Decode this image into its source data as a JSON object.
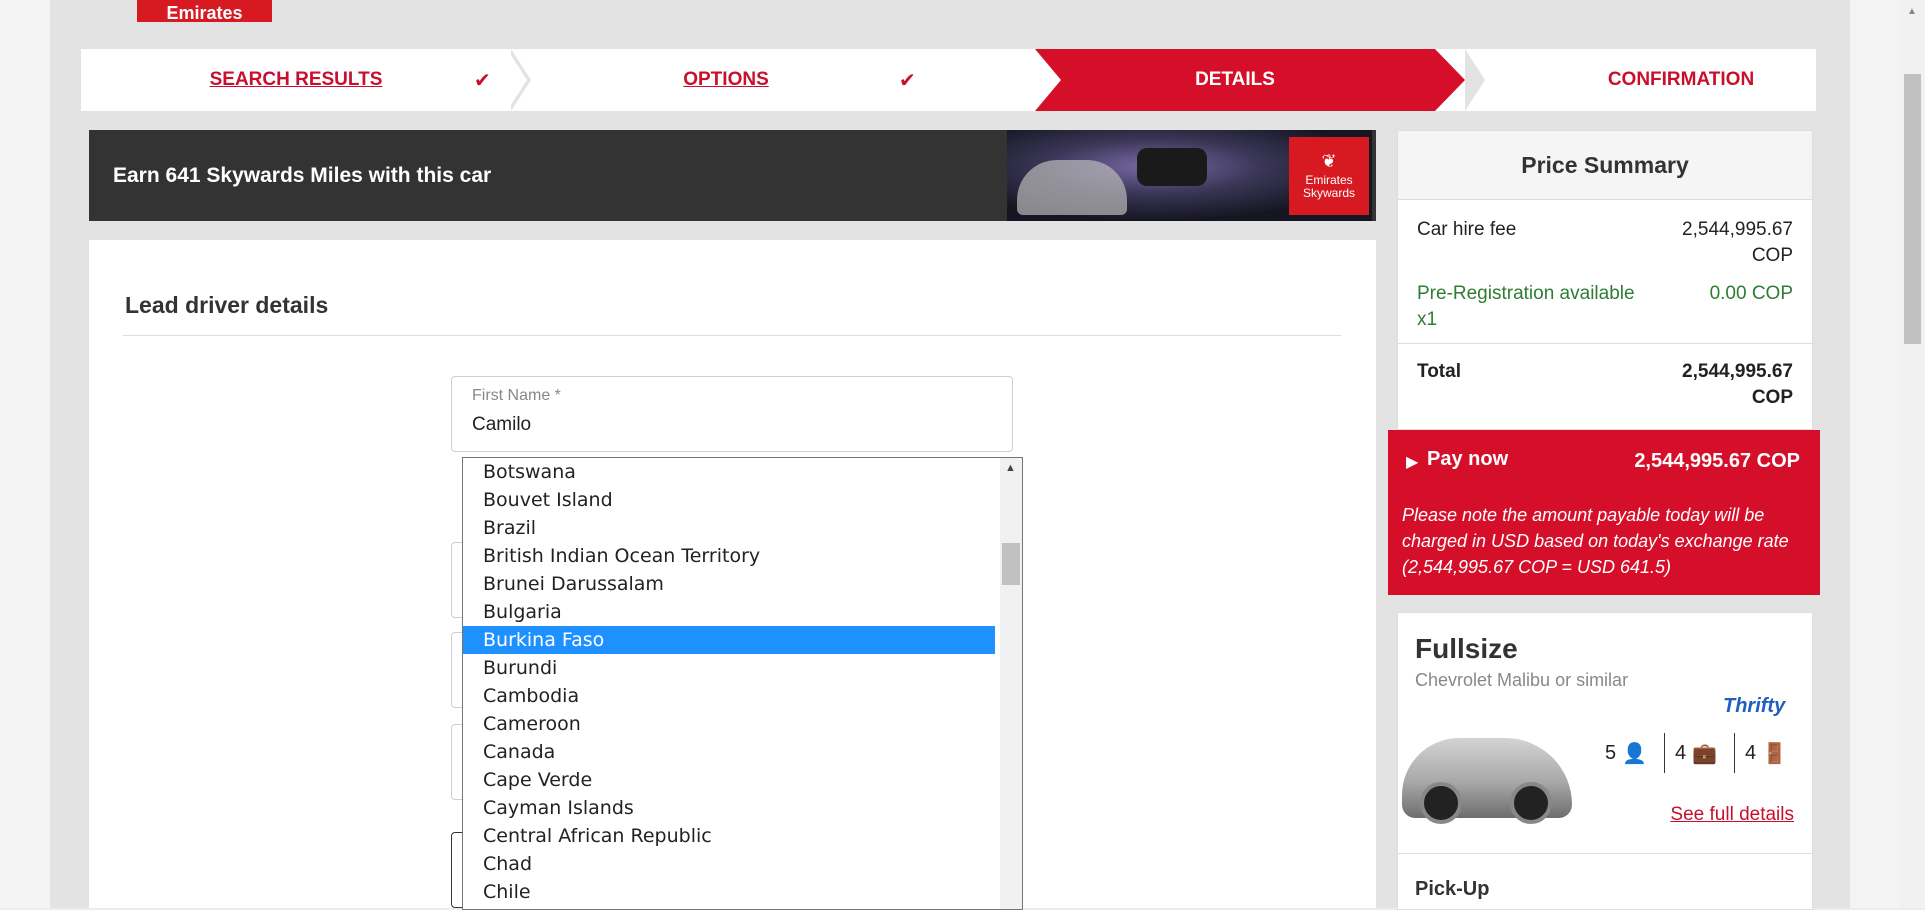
{
  "brand": {
    "logo_text": "Emirates"
  },
  "steps": [
    {
      "label": "SEARCH RESULTS",
      "done": true
    },
    {
      "label": "OPTIONS",
      "done": true
    },
    {
      "label": "DETAILS",
      "active": true
    },
    {
      "label": "CONFIRMATION"
    }
  ],
  "banner": {
    "text": "Earn 641 Skywards Miles with this car",
    "logo_line1": "Emirates",
    "logo_line2": "Skywards"
  },
  "form": {
    "section_title": "Lead driver details",
    "first_name": {
      "label": "First Name *",
      "value": "Camilo"
    }
  },
  "country_dropdown": {
    "selected": "Burkina Faso",
    "items": [
      "Botswana",
      "Bouvet Island",
      "Brazil",
      "British Indian Ocean Territory",
      "Brunei Darussalam",
      "Bulgaria",
      "Burkina Faso",
      "Burundi",
      "Cambodia",
      "Cameroon",
      "Canada",
      "Cape Verde",
      "Cayman Islands",
      "Central African Republic",
      "Chad",
      "Chile"
    ]
  },
  "price_summary": {
    "title": "Price Summary",
    "car_hire_label": "Car hire fee",
    "car_hire_value": "2,544,995.67 COP",
    "prereg_label": "Pre-Registration available x1",
    "prereg_value": "0.00 COP",
    "total_label": "Total",
    "total_value": "2,544,995.67 COP"
  },
  "pay_now": {
    "label": "Pay now",
    "value": "2,544,995.67 COP",
    "note": "Please note the amount payable today will be charged in USD based on today's exchange rate (2,544,995.67 COP = USD 641.5)"
  },
  "car": {
    "class": "Fullsize",
    "model": "Chevrolet Malibu or similar",
    "supplier": "Thrifty",
    "passengers": "5",
    "bags": "4",
    "doors": "4",
    "see_details": "See full details",
    "pickup_label": "Pick-Up"
  },
  "colors": {
    "brand_red": "#d50f29",
    "selected_blue": "#1e90ff",
    "green": "#2e7d32"
  }
}
